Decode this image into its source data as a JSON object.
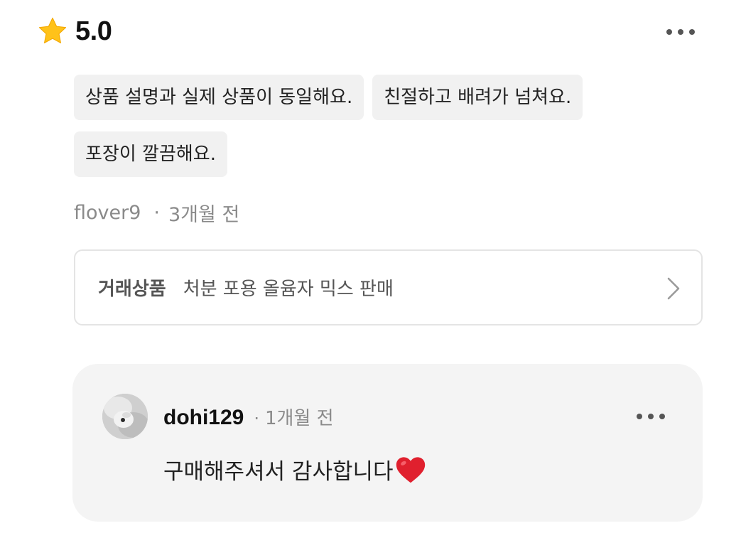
{
  "review": {
    "rating": "5.0",
    "tags": [
      "상품 설명과 실제 상품이 동일해요.",
      "친절하고 배려가 넘쳐요.",
      "포장이 깔끔해요."
    ],
    "author": "flover9",
    "separator": "·",
    "time": "3개월 전",
    "product": {
      "label": "거래상품",
      "name": "처분 포용 올윰자 믹스 판매"
    }
  },
  "reply": {
    "user": "dohi129",
    "separator": "·",
    "time": "1개월 전",
    "text": "구매해주셔서 감사합니다"
  },
  "icons": {
    "star": "star-icon",
    "more": "more-options-icon",
    "chevron": "chevron-right-icon",
    "heart": "heart-icon"
  },
  "colors": {
    "star": "#FFC21A",
    "heart": "#E0202E",
    "tag_bg": "#F1F1F1",
    "reply_bg": "#F4F4F4",
    "muted_text": "#8A8A8A"
  }
}
